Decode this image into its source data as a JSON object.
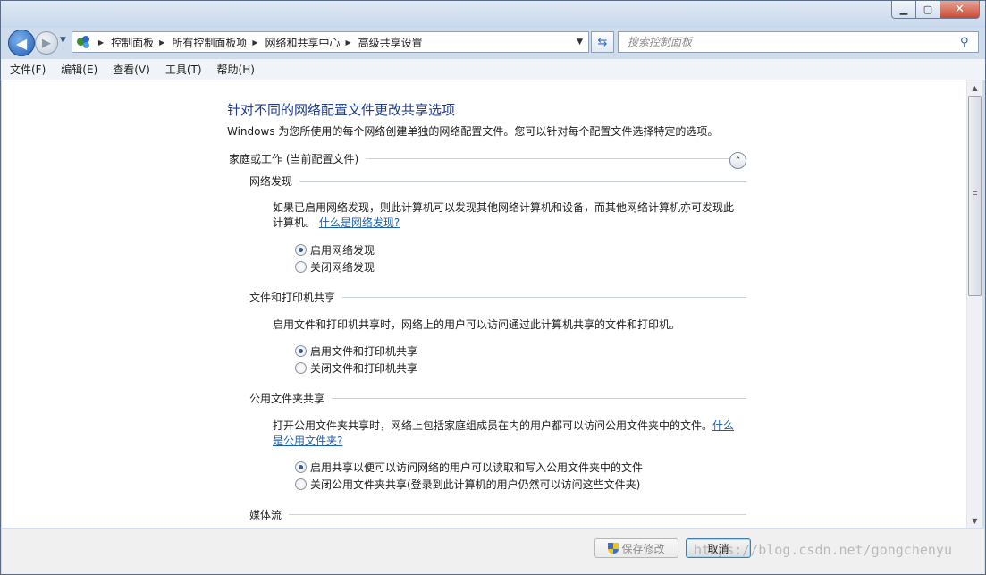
{
  "window": {
    "caption": {
      "minimize": "▁",
      "maximize": "▢",
      "close": "✕"
    }
  },
  "nav": {
    "back_icon": "◀",
    "forward_icon": "▶",
    "breadcrumbs": [
      "控制面板",
      "所有控制面板项",
      "网络和共享中心",
      "高级共享设置"
    ],
    "search_placeholder": "搜索控制面板"
  },
  "menu": [
    "文件(F)",
    "编辑(E)",
    "查看(V)",
    "工具(T)",
    "帮助(H)"
  ],
  "page": {
    "title": "针对不同的网络配置文件更改共享选项",
    "description": "Windows 为您所使用的每个网络创建单独的网络配置文件。您可以针对每个配置文件选择特定的选项。",
    "profile_label": "家庭或工作 (当前配置文件)",
    "sections": [
      {
        "heading": "网络发现",
        "text": "如果已启用网络发现，则此计算机可以发现其他网络计算机和设备，而其他网络计算机亦可发现此计算机。",
        "link": "什么是网络发现?",
        "options": [
          {
            "label": "启用网络发现",
            "selected": true
          },
          {
            "label": "关闭网络发现",
            "selected": false
          }
        ]
      },
      {
        "heading": "文件和打印机共享",
        "text": "启用文件和打印机共享时，网络上的用户可以访问通过此计算机共享的文件和打印机。",
        "options": [
          {
            "label": "启用文件和打印机共享",
            "selected": true
          },
          {
            "label": "关闭文件和打印机共享",
            "selected": false
          }
        ]
      },
      {
        "heading": "公用文件夹共享",
        "text": "打开公用文件夹共享时，网络上包括家庭组成员在内的用户都可以访问公用文件夹中的文件。",
        "link_line1": "什么",
        "link_line2": "是公用文件夹?",
        "options": [
          {
            "label": "启用共享以便可以访问网络的用户可以读取和写入公用文件夹中的文件",
            "selected": true
          },
          {
            "label": "关闭公用文件夹共享(登录到此计算机的用户仍然可以访问这些文件夹)",
            "selected": false
          }
        ]
      },
      {
        "heading": "媒体流"
      }
    ]
  },
  "footer": {
    "save_label": "保存修改",
    "cancel_label": "取消"
  },
  "watermark": "https://blog.csdn.net/gongchenyu"
}
